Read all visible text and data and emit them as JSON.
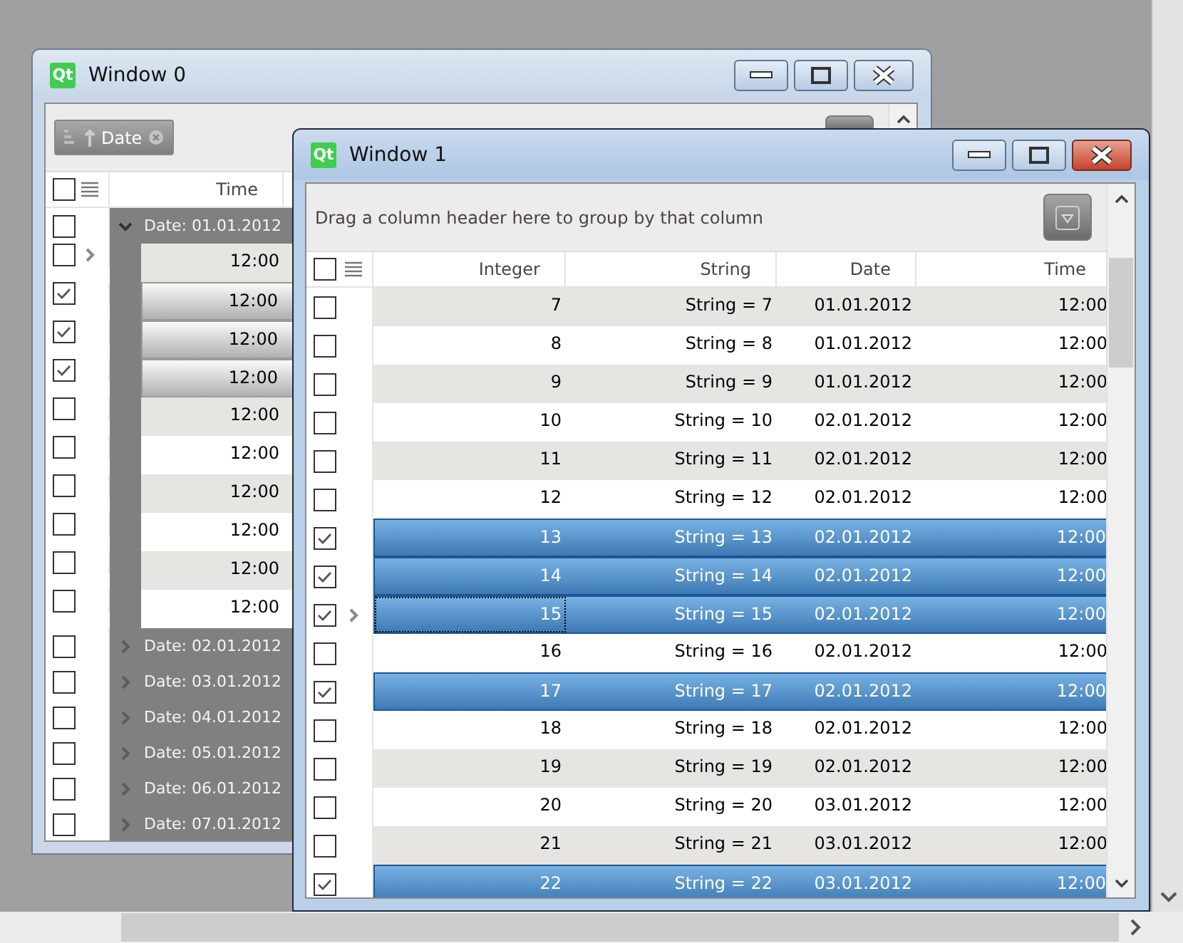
{
  "windows": [
    {
      "title": "Window 0",
      "logo": "Qt",
      "active": false,
      "group_panel": {
        "chips": [
          {
            "label": "Date"
          }
        ]
      },
      "header_checked": false,
      "columns": [
        "Time"
      ],
      "rows": [
        {
          "kind": "group",
          "label": "Date: 01.01.2012",
          "checked": false,
          "expanded": true,
          "children": [
            {
              "kind": "data",
              "cells": [
                "12:00"
              ],
              "checked": false,
              "selected": false,
              "current": true
            },
            {
              "kind": "data",
              "cells": [
                "12:00"
              ],
              "checked": true,
              "selected": true,
              "current": false
            },
            {
              "kind": "data",
              "cells": [
                "12:00"
              ],
              "checked": true,
              "selected": true,
              "current": false
            },
            {
              "kind": "data",
              "cells": [
                "12:00"
              ],
              "checked": true,
              "selected": true,
              "current": false
            },
            {
              "kind": "data",
              "cells": [
                "12:00"
              ],
              "checked": false,
              "selected": false,
              "current": false
            },
            {
              "kind": "data",
              "cells": [
                "12:00"
              ],
              "checked": false,
              "selected": false,
              "current": false
            },
            {
              "kind": "data",
              "cells": [
                "12:00"
              ],
              "checked": false,
              "selected": false,
              "current": false
            },
            {
              "kind": "data",
              "cells": [
                "12:00"
              ],
              "checked": false,
              "selected": false,
              "current": false
            },
            {
              "kind": "data",
              "cells": [
                "12:00"
              ],
              "checked": false,
              "selected": false,
              "current": false
            },
            {
              "kind": "data",
              "cells": [
                "12:00"
              ],
              "checked": false,
              "selected": false,
              "current": false
            }
          ]
        },
        {
          "kind": "group",
          "label": "Date: 02.01.2012",
          "checked": false,
          "expanded": false
        },
        {
          "kind": "group",
          "label": "Date: 03.01.2012",
          "checked": false,
          "expanded": false
        },
        {
          "kind": "group",
          "label": "Date: 04.01.2012",
          "checked": false,
          "expanded": false
        },
        {
          "kind": "group",
          "label": "Date: 05.01.2012",
          "checked": false,
          "expanded": false
        },
        {
          "kind": "group",
          "label": "Date: 06.01.2012",
          "checked": false,
          "expanded": false
        },
        {
          "kind": "group",
          "label": "Date: 07.01.2012",
          "checked": false,
          "expanded": false
        }
      ]
    },
    {
      "title": "Window 1",
      "logo": "Qt",
      "active": true,
      "group_panel": {
        "hint": "Drag a column header here to group by that column"
      },
      "header_checked": false,
      "columns": [
        "Integer",
        "String",
        "Date",
        "Time"
      ],
      "rows": [
        {
          "kind": "data",
          "cells": [
            "7",
            "String = 7",
            "01.01.2012",
            "12:00"
          ],
          "checked": false,
          "selected": false,
          "current": false
        },
        {
          "kind": "data",
          "cells": [
            "8",
            "String = 8",
            "01.01.2012",
            "12:00"
          ],
          "checked": false,
          "selected": false,
          "current": false
        },
        {
          "kind": "data",
          "cells": [
            "9",
            "String = 9",
            "01.01.2012",
            "12:00"
          ],
          "checked": false,
          "selected": false,
          "current": false
        },
        {
          "kind": "data",
          "cells": [
            "10",
            "String = 10",
            "02.01.2012",
            "12:00"
          ],
          "checked": false,
          "selected": false,
          "current": false
        },
        {
          "kind": "data",
          "cells": [
            "11",
            "String = 11",
            "02.01.2012",
            "12:00"
          ],
          "checked": false,
          "selected": false,
          "current": false
        },
        {
          "kind": "data",
          "cells": [
            "12",
            "String = 12",
            "02.01.2012",
            "12:00"
          ],
          "checked": false,
          "selected": false,
          "current": false
        },
        {
          "kind": "data",
          "cells": [
            "13",
            "String = 13",
            "02.01.2012",
            "12:00"
          ],
          "checked": true,
          "selected": true,
          "current": false
        },
        {
          "kind": "data",
          "cells": [
            "14",
            "String = 14",
            "02.01.2012",
            "12:00"
          ],
          "checked": true,
          "selected": true,
          "current": false
        },
        {
          "kind": "data",
          "cells": [
            "15",
            "String = 15",
            "02.01.2012",
            "12:00"
          ],
          "checked": true,
          "selected": true,
          "current": true
        },
        {
          "kind": "data",
          "cells": [
            "16",
            "String = 16",
            "02.01.2012",
            "12:00"
          ],
          "checked": false,
          "selected": false,
          "current": false
        },
        {
          "kind": "data",
          "cells": [
            "17",
            "String = 17",
            "02.01.2012",
            "12:00"
          ],
          "checked": true,
          "selected": true,
          "current": false
        },
        {
          "kind": "data",
          "cells": [
            "18",
            "String = 18",
            "02.01.2012",
            "12:00"
          ],
          "checked": false,
          "selected": false,
          "current": false
        },
        {
          "kind": "data",
          "cells": [
            "19",
            "String = 19",
            "02.01.2012",
            "12:00"
          ],
          "checked": false,
          "selected": false,
          "current": false
        },
        {
          "kind": "data",
          "cells": [
            "20",
            "String = 20",
            "03.01.2012",
            "12:00"
          ],
          "checked": false,
          "selected": false,
          "current": false
        },
        {
          "kind": "data",
          "cells": [
            "21",
            "String = 21",
            "03.01.2012",
            "12:00"
          ],
          "checked": false,
          "selected": false,
          "current": false
        },
        {
          "kind": "data",
          "cells": [
            "22",
            "String = 22",
            "03.01.2012",
            "12:00"
          ],
          "checked": true,
          "selected": true,
          "current": false
        }
      ]
    }
  ]
}
